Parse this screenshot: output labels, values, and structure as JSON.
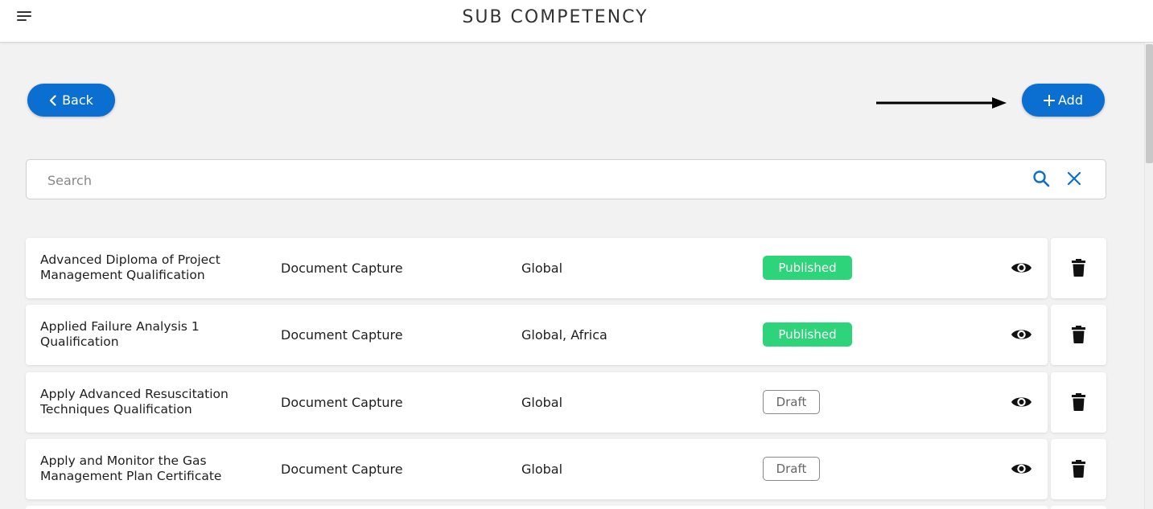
{
  "header": {
    "title": "SUB COMPETENCY",
    "menu_icon": "hamburger-menu-icon"
  },
  "actions": {
    "back_label": "Back",
    "add_label": "Add"
  },
  "search": {
    "placeholder": "Search",
    "value": ""
  },
  "rows": [
    {
      "name": "Advanced Diploma of Project Management Qualification",
      "type": "Document Capture",
      "region": "Global",
      "status": "Published"
    },
    {
      "name": "Applied Failure Analysis 1 Qualification",
      "type": "Document Capture",
      "region": "Global, Africa",
      "status": "Published"
    },
    {
      "name": "Apply Advanced Resuscitation Techniques Qualification",
      "type": "Document Capture",
      "region": "Global",
      "status": "Draft"
    },
    {
      "name": "Apply and Monitor the Gas Management Plan Certificate",
      "type": "Document Capture",
      "region": "Global",
      "status": "Draft"
    }
  ],
  "colors": {
    "primary": "#0a6fd1",
    "published": "#2ed47a",
    "draft_border": "#888888"
  }
}
